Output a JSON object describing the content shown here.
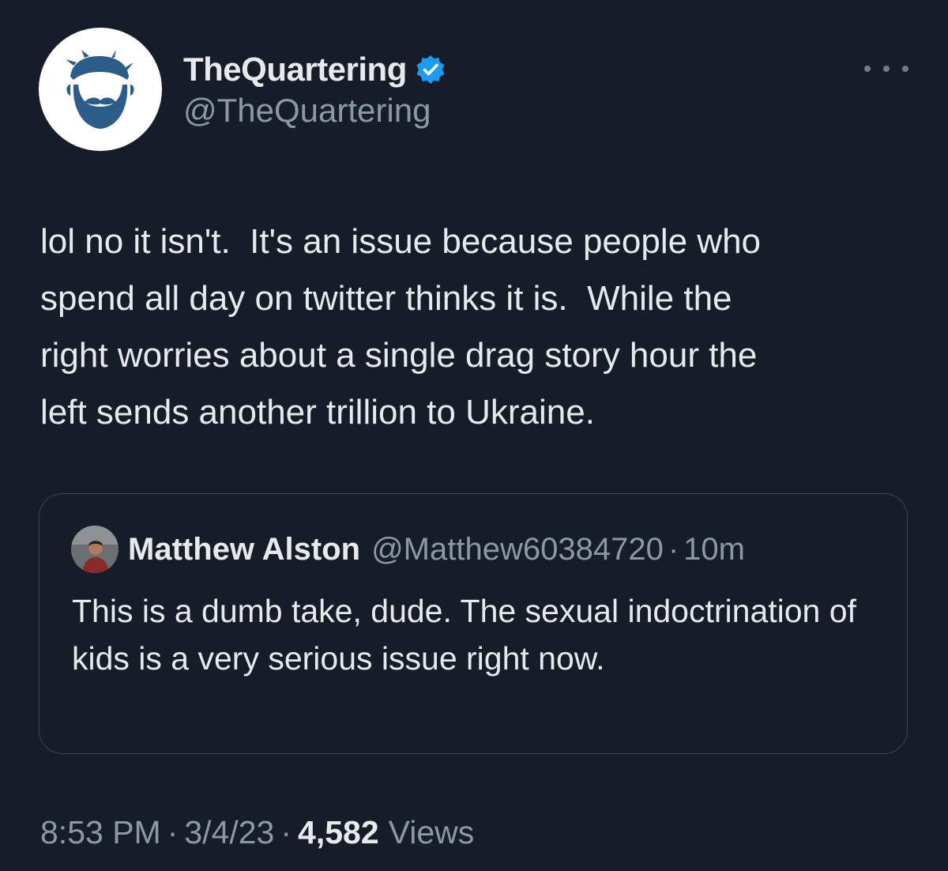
{
  "tweet": {
    "author": {
      "display_name": "TheQuartering",
      "handle": "@TheQuartering",
      "verified": true,
      "avatar_icon": "bearded-man-logo-icon"
    },
    "more_icon": "more-options-icon",
    "text": "lol no it isn't.  It's an issue because people who\nspend all day on twitter thinks it is.  While the\nright worries about a single drag story hour the\nleft sends another trillion to Ukraine.",
    "quote": {
      "author_name": "Matthew Alston",
      "author_handle": "@Matthew60384720",
      "separator": "·",
      "time": "10m",
      "text": "This is a dumb take, dude. The sexual indoctrination of kids is a very serious issue right now."
    },
    "meta": {
      "time": "8:53 PM",
      "date": "3/4/23",
      "separator": "·",
      "views_count": "4,582",
      "views_label": "Views"
    }
  },
  "colors": {
    "background": "#161d29",
    "text_primary": "#e7e9ea",
    "text_secondary": "#8b98a5",
    "verified_blue": "#1d9bf0",
    "avatar_logo_blue": "#2c5d89",
    "quote_border": "#3a4451"
  }
}
